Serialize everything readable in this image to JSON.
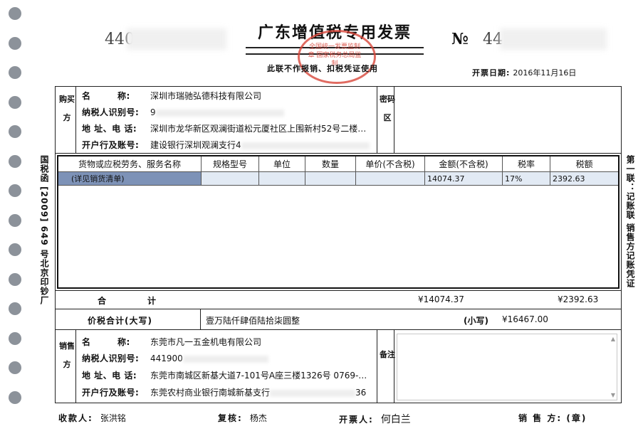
{
  "header": {
    "title": "广东增值税专用发票",
    "subtitle": "此联不作报销、扣税凭证使用",
    "code_prefix": "440",
    "no_label": "№",
    "no_prefix": "44",
    "date_label": "开票日期:",
    "date_value": "2016年11月16日",
    "seal_text": "全国统一发票监制章 国家税务总局监制"
  },
  "side": {
    "left": "国税函 [2009] 649 号北京印钞厂",
    "right": "第一联：记账联 销售方记账凭证"
  },
  "buyer": {
    "section_label": "购买方",
    "name_label": "名　　　称:",
    "name_value": "深圳市瑞驰弘德科技有限公司",
    "taxid_label": "纳税人识别号:",
    "taxid_value": "9",
    "addr_label": "地 址、电 话:",
    "addr_value": "深圳市龙华新区观澜街道松元厦社区上围新村52号二楼…",
    "bank_label": "开户行及账号:",
    "bank_value": "建设银行深圳观澜支行4",
    "cipher_label": "密码区"
  },
  "goods": {
    "headers": [
      "货物或应税劳务、服务名称",
      "规格型号",
      "单位",
      "数量",
      "单价(不含税)",
      "金额(不含税)",
      "税率",
      "税额"
    ],
    "rows": [
      [
        "(详见销货清单)",
        "",
        "",
        "",
        "",
        "14074.37",
        "17%",
        "2392.63"
      ]
    ]
  },
  "totals": {
    "label": "合　　　　计",
    "amount": "¥14074.37",
    "tax": "¥2392.63"
  },
  "tax_total": {
    "label": "价税合计(大写)",
    "uppercase": "壹万陆仟肆佰陆拾柒圆整",
    "small_label": "(小写)",
    "small_value": "¥16467.00"
  },
  "seller": {
    "section_label": "销售方",
    "name_label": "名　　　称:",
    "name_value": "东莞市凡一五金机电有限公司",
    "taxid_label": "纳税人识别号:",
    "taxid_value": "441900",
    "addr_label": "地 址、电 话:",
    "addr_value": "东莞市南城区新基大道7-101号A座三楼1326号  0769-…",
    "bank_label": "开户行及账号:",
    "bank_value": "东莞农村商业银行南城新基支行",
    "bank_suffix": "36",
    "remark_label": "备注"
  },
  "footer": {
    "payee_label": "收款人:",
    "payee_value": "张洪铭",
    "review_label": "复核:",
    "review_value": "杨杰",
    "issuer_label": "开票人:",
    "issuer_value": "何白兰",
    "seller_label": "销 售 方: (章)"
  },
  "colors": {
    "selected_cell": "#7d92b7",
    "row_bg": "#e2eaf4",
    "seal": "#d8463a"
  }
}
